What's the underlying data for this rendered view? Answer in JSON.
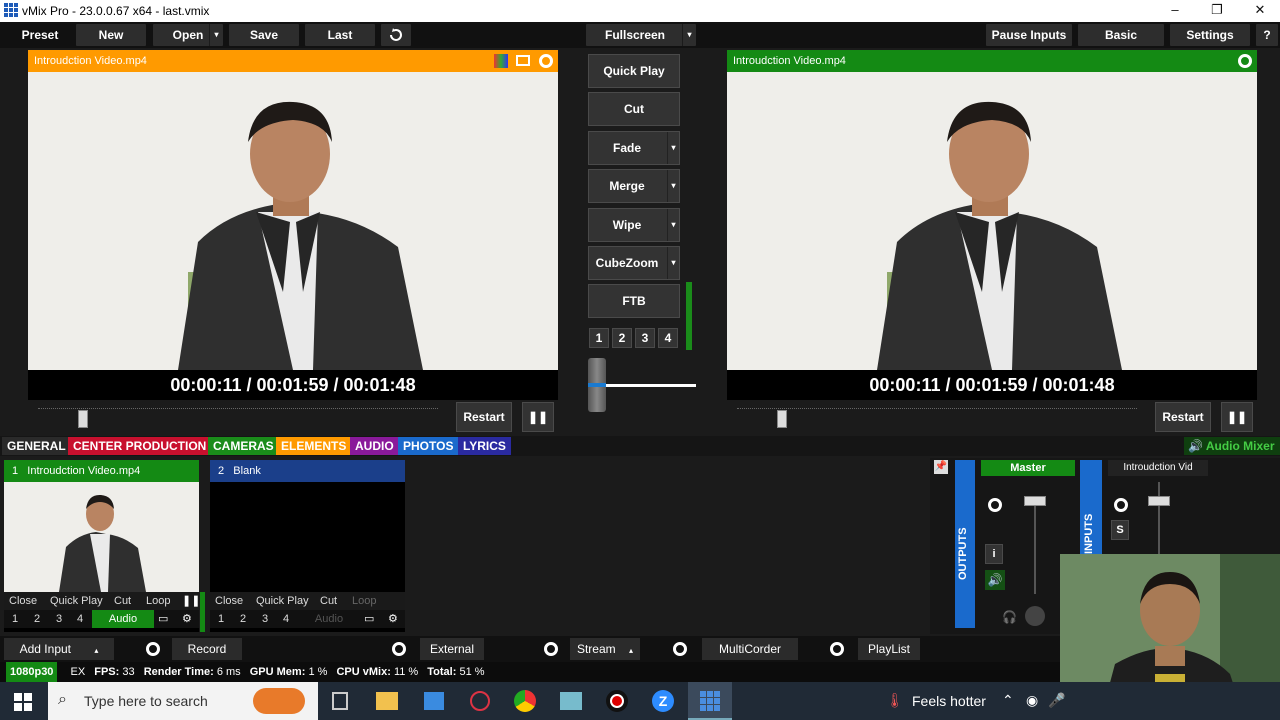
{
  "window": {
    "title": "vMix Pro - 23.0.0.67 x64 - last.vmix",
    "controls": [
      "–",
      "❐",
      "✕"
    ]
  },
  "toolbar": {
    "preset": "Preset",
    "new": "New",
    "open": "Open",
    "save": "Save",
    "last": "Last",
    "fullscreen": "Fullscreen",
    "pause_inputs": "Pause Inputs",
    "basic": "Basic",
    "settings": "Settings",
    "help": "?"
  },
  "preview": {
    "title": "Introudction Video.mp4",
    "timecode": "00:00:11  /  00:01:59  /  00:01:48",
    "restart": "Restart",
    "header_color": "#ff9a00",
    "progress": 0.1
  },
  "output": {
    "title": "Introudction Video.mp4",
    "timecode": "00:00:11  /  00:01:59  /  00:01:48",
    "restart": "Restart",
    "header_color": "#148a14",
    "progress": 0.1
  },
  "transitions": {
    "quick_play": "Quick Play",
    "cut": "Cut",
    "fade": "Fade",
    "merge": "Merge",
    "wipe": "Wipe",
    "cubezoom": "CubeZoom",
    "ftb": "FTB",
    "numbers": [
      "1",
      "2",
      "3",
      "4"
    ]
  },
  "tabs": [
    {
      "label": "GENERAL",
      "color": "#2a2a2a"
    },
    {
      "label": "CENTER PRODUCTION",
      "color": "#c8102e"
    },
    {
      "label": "CAMERAS",
      "color": "#1a8c1a"
    },
    {
      "label": "ELEMENTS",
      "color": "#ff9a00"
    },
    {
      "label": "AUDIO",
      "color": "#8a1a9a"
    },
    {
      "label": "PHOTOS",
      "color": "#1a6acc"
    },
    {
      "label": "LYRICS",
      "color": "#2a2aa0"
    }
  ],
  "audio_mixer_label": "Audio Mixer",
  "inputs": [
    {
      "number": "1",
      "name": "Introudction Video.mp4",
      "controls": [
        "Close",
        "Quick Play",
        "Cut",
        "Loop"
      ],
      "numbers": [
        "1",
        "2",
        "3",
        "4"
      ],
      "audio": "Audio"
    },
    {
      "number": "2",
      "name": "Blank",
      "controls": [
        "Close",
        "Quick Play",
        "Cut",
        "Loop"
      ],
      "numbers": [
        "1",
        "2",
        "3",
        "4"
      ],
      "audio": "Audio"
    }
  ],
  "mixer": {
    "outputs_label": "OUTPUTS",
    "inputs_label": "INPUTS",
    "master": "Master",
    "channel": "Introudction Vid",
    "info": "i",
    "solo": "S"
  },
  "bottom": {
    "add_input": "Add Input",
    "record": "Record",
    "external": "External",
    "stream": "Stream",
    "multicorder": "MultiCorder",
    "playlist": "PlayList"
  },
  "status": {
    "format": "1080p30",
    "ex": "EX",
    "fps_label": "FPS:",
    "fps": "33",
    "render_label": "Render Time:",
    "render": "6 ms",
    "gpu_label": "GPU Mem:",
    "gpu": "1 %",
    "cpu_label": "CPU vMix:",
    "cpu": "11 %",
    "total_label": "Total:",
    "total": "51 %"
  },
  "taskbar": {
    "search_placeholder": "Type here to search",
    "weather": "Feels hotter"
  }
}
